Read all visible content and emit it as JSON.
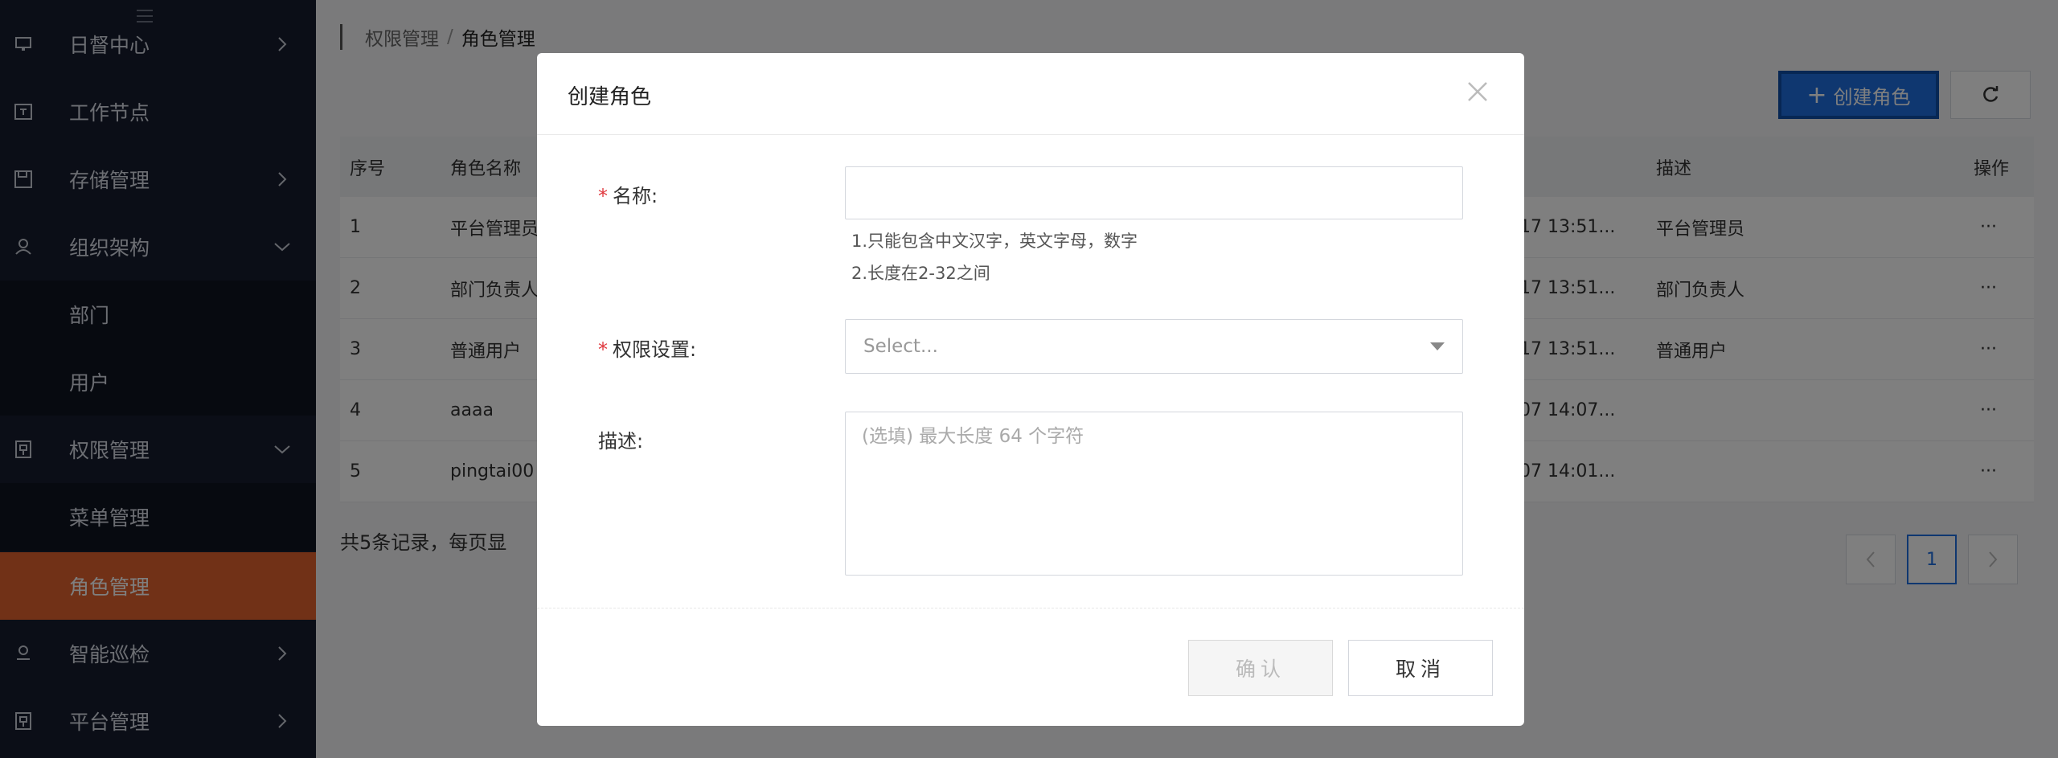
{
  "sidebar": {
    "items": [
      {
        "label": "日督中心",
        "icon": "monitor-icon"
      },
      {
        "label": "工作节点",
        "icon": "server-icon"
      },
      {
        "label": "存储管理",
        "icon": "save-icon"
      },
      {
        "label": "组织架构",
        "icon": "users-icon"
      },
      {
        "label": "部门"
      },
      {
        "label": "用户"
      },
      {
        "label": "权限管理",
        "icon": "shield-icon"
      },
      {
        "label": "菜单管理"
      },
      {
        "label": "角色管理"
      },
      {
        "label": "智能巡检",
        "icon": "user-icon"
      },
      {
        "label": "平台管理",
        "icon": "shield-icon"
      }
    ]
  },
  "breadcrumb": {
    "parent": "权限管理",
    "separator": "/",
    "current": "角色管理"
  },
  "toolbar": {
    "create_label": "创建角色",
    "create_icon": "+"
  },
  "table": {
    "columns": [
      "序号",
      "角色名称",
      "描述",
      "操作"
    ],
    "rows": [
      {
        "index": "1",
        "name": "平台管理员",
        "time": "17 13:51...",
        "desc": "平台管理员",
        "op": "···"
      },
      {
        "index": "2",
        "name": "部门负责人",
        "time": "17 13:51...",
        "desc": "部门负责人",
        "op": "···"
      },
      {
        "index": "3",
        "name": "普通用户",
        "time": "17 13:51...",
        "desc": "普通用户",
        "op": "···"
      },
      {
        "index": "4",
        "name": "aaaa",
        "time": "07 14:07...",
        "desc": "",
        "op": "···"
      },
      {
        "index": "5",
        "name": "pingtai00",
        "time": "07 14:01...",
        "desc": "",
        "op": "···"
      }
    ]
  },
  "pagination": {
    "summary": "共5条记录，每页显",
    "current_page": "1"
  },
  "modal": {
    "title": "创建角色",
    "name_label": "名称:",
    "name_hint_1": "1.只能包含中文汉字，英文字母，数字",
    "name_hint_2": "2.长度在2-32之间",
    "perm_label": "权限设置:",
    "perm_placeholder": "Select...",
    "desc_label": "描述:",
    "desc_placeholder": "(选填) 最大长度 64 个字符",
    "required_mark": "*",
    "ok_label": "确认",
    "cancel_label": "取消"
  },
  "colors": {
    "sidebar_bg": "#171d2e",
    "active_item": "#e2622f",
    "primary": "#1f6fe0",
    "required": "#e0383e"
  }
}
